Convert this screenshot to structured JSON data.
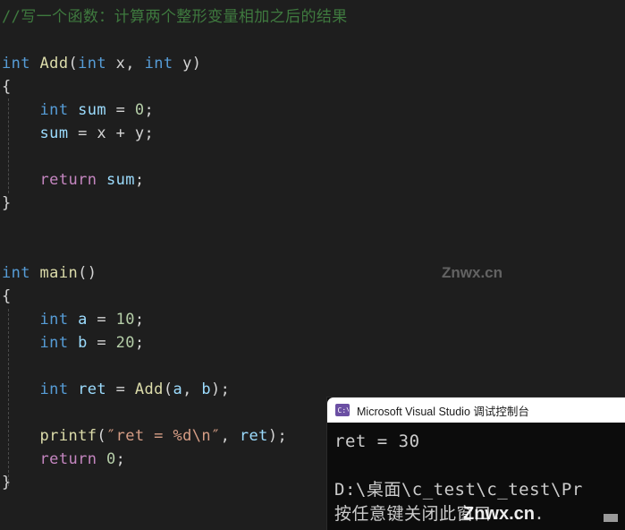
{
  "editor": {
    "background": "#1e1e1e",
    "lines": [
      {
        "tokens": [
          {
            "t": "//写一个函数：计算两个整形变量相加之后的结果",
            "c": "t-comment"
          }
        ]
      },
      {
        "tokens": [
          {
            "t": "",
            "c": "t-plain"
          }
        ]
      },
      {
        "tokens": [
          {
            "t": "int",
            "c": "t-kw"
          },
          {
            "t": " ",
            "c": "t-plain"
          },
          {
            "t": "Add",
            "c": "t-fn"
          },
          {
            "t": "(",
            "c": "t-punc"
          },
          {
            "t": "int",
            "c": "t-kw"
          },
          {
            "t": " ",
            "c": "t-plain"
          },
          {
            "t": "x",
            "c": "t-plain"
          },
          {
            "t": ", ",
            "c": "t-punc"
          },
          {
            "t": "int",
            "c": "t-kw"
          },
          {
            "t": " ",
            "c": "t-plain"
          },
          {
            "t": "y",
            "c": "t-plain"
          },
          {
            "t": ")",
            "c": "t-punc"
          }
        ]
      },
      {
        "tokens": [
          {
            "t": "{",
            "c": "t-punc"
          }
        ]
      },
      {
        "tokens": [
          {
            "t": "    ",
            "c": "t-plain"
          },
          {
            "t": "int",
            "c": "t-kw"
          },
          {
            "t": " ",
            "c": "t-plain"
          },
          {
            "t": "sum",
            "c": "t-var"
          },
          {
            "t": " = ",
            "c": "t-punc"
          },
          {
            "t": "0",
            "c": "t-num"
          },
          {
            "t": ";",
            "c": "t-punc"
          }
        ]
      },
      {
        "tokens": [
          {
            "t": "    ",
            "c": "t-plain"
          },
          {
            "t": "sum",
            "c": "t-var"
          },
          {
            "t": " = ",
            "c": "t-punc"
          },
          {
            "t": "x",
            "c": "t-plain"
          },
          {
            "t": " + ",
            "c": "t-punc"
          },
          {
            "t": "y",
            "c": "t-plain"
          },
          {
            "t": ";",
            "c": "t-punc"
          }
        ]
      },
      {
        "tokens": [
          {
            "t": "",
            "c": "t-plain"
          }
        ]
      },
      {
        "tokens": [
          {
            "t": "    ",
            "c": "t-plain"
          },
          {
            "t": "return",
            "c": "t-ctl"
          },
          {
            "t": " ",
            "c": "t-plain"
          },
          {
            "t": "sum",
            "c": "t-var"
          },
          {
            "t": ";",
            "c": "t-punc"
          }
        ]
      },
      {
        "tokens": [
          {
            "t": "}",
            "c": "t-punc"
          }
        ]
      },
      {
        "tokens": [
          {
            "t": "",
            "c": "t-plain"
          }
        ]
      },
      {
        "tokens": [
          {
            "t": "",
            "c": "t-plain"
          }
        ]
      },
      {
        "tokens": [
          {
            "t": "int",
            "c": "t-kw"
          },
          {
            "t": " ",
            "c": "t-plain"
          },
          {
            "t": "main",
            "c": "t-fn"
          },
          {
            "t": "()",
            "c": "t-punc"
          }
        ]
      },
      {
        "tokens": [
          {
            "t": "{",
            "c": "t-punc"
          }
        ]
      },
      {
        "tokens": [
          {
            "t": "    ",
            "c": "t-plain"
          },
          {
            "t": "int",
            "c": "t-kw"
          },
          {
            "t": " ",
            "c": "t-plain"
          },
          {
            "t": "a",
            "c": "t-var"
          },
          {
            "t": " = ",
            "c": "t-punc"
          },
          {
            "t": "10",
            "c": "t-num"
          },
          {
            "t": ";",
            "c": "t-punc"
          }
        ]
      },
      {
        "tokens": [
          {
            "t": "    ",
            "c": "t-plain"
          },
          {
            "t": "int",
            "c": "t-kw"
          },
          {
            "t": " ",
            "c": "t-plain"
          },
          {
            "t": "b",
            "c": "t-var"
          },
          {
            "t": " = ",
            "c": "t-punc"
          },
          {
            "t": "20",
            "c": "t-num"
          },
          {
            "t": ";",
            "c": "t-punc"
          }
        ]
      },
      {
        "tokens": [
          {
            "t": "",
            "c": "t-plain"
          }
        ]
      },
      {
        "tokens": [
          {
            "t": "    ",
            "c": "t-plain"
          },
          {
            "t": "int",
            "c": "t-kw"
          },
          {
            "t": " ",
            "c": "t-plain"
          },
          {
            "t": "ret",
            "c": "t-var"
          },
          {
            "t": " = ",
            "c": "t-punc"
          },
          {
            "t": "Add",
            "c": "t-fn"
          },
          {
            "t": "(",
            "c": "t-punc"
          },
          {
            "t": "a",
            "c": "t-var"
          },
          {
            "t": ", ",
            "c": "t-punc"
          },
          {
            "t": "b",
            "c": "t-var"
          },
          {
            "t": ");",
            "c": "t-punc"
          }
        ]
      },
      {
        "tokens": [
          {
            "t": "",
            "c": "t-plain"
          }
        ]
      },
      {
        "tokens": [
          {
            "t": "    ",
            "c": "t-plain"
          },
          {
            "t": "printf",
            "c": "t-fn"
          },
          {
            "t": "(",
            "c": "t-punc"
          },
          {
            "t": "″ret = %d\\n″",
            "c": "t-str"
          },
          {
            "t": ", ",
            "c": "t-punc"
          },
          {
            "t": "ret",
            "c": "t-var"
          },
          {
            "t": ");",
            "c": "t-punc"
          }
        ]
      },
      {
        "tokens": [
          {
            "t": "    ",
            "c": "t-plain"
          },
          {
            "t": "return",
            "c": "t-ctl"
          },
          {
            "t": " ",
            "c": "t-plain"
          },
          {
            "t": "0",
            "c": "t-num"
          },
          {
            "t": ";",
            "c": "t-punc"
          }
        ]
      },
      {
        "tokens": [
          {
            "t": "}",
            "c": "t-punc"
          }
        ]
      }
    ]
  },
  "console": {
    "title": "Microsoft Visual Studio 调试控制台",
    "icon": "console-cmd-icon",
    "output": [
      "ret = 30",
      "",
      "D:\\桌面\\c_test\\c_test\\Pr",
      "按任意键关闭此窗口. . ."
    ]
  },
  "watermarks": [
    {
      "text": "Znwx.cn"
    },
    {
      "text": "Znwx.cn"
    }
  ]
}
